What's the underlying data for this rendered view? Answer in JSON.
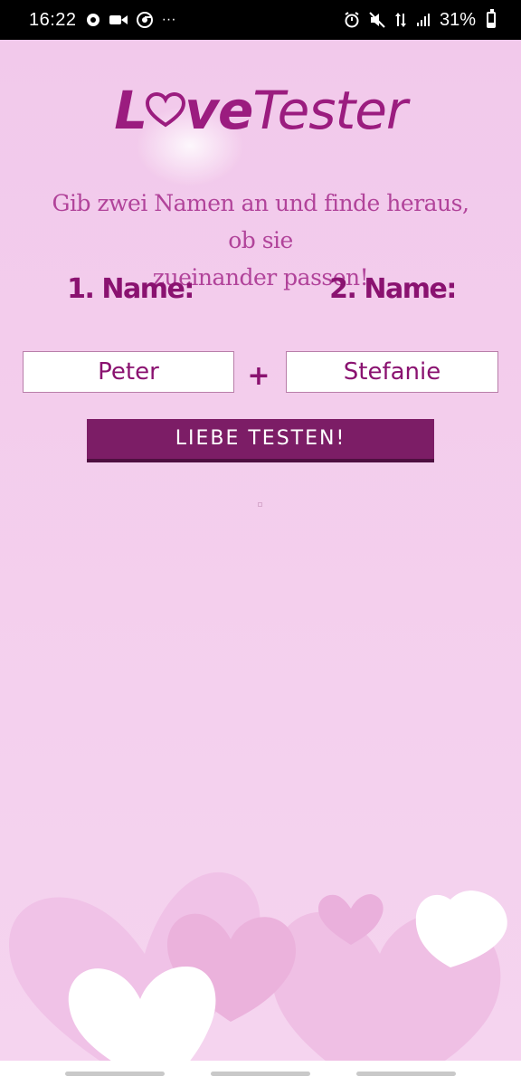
{
  "status_bar": {
    "time": "16:22",
    "left_icons": [
      "chat-bubble-icon",
      "video-camera-icon",
      "chrome-icon",
      "more-dots-icon"
    ],
    "more_glyph": "···",
    "right_icons": [
      "alarm-icon",
      "mute-icon",
      "data-arrows-icon",
      "signal-icon"
    ],
    "battery_percent": "31%",
    "battery_level": 0.31
  },
  "logo": {
    "part1": "L",
    "part2": "ve",
    "part3": "Tester"
  },
  "intro": {
    "line1": "Gib zwei Namen an und finde heraus, ob sie",
    "line2": "zueinander passen!"
  },
  "form": {
    "label1": "1. Name:",
    "label2": "2. Name:",
    "name1_value": "Peter",
    "name2_value": "Stefanie",
    "plus": "+",
    "button_label": "LIEBE TESTEN!"
  },
  "colors": {
    "background": "#f2c9eb",
    "accent": "#8a1270",
    "button": "#7c1d66",
    "intro_text": "#b1439a"
  }
}
